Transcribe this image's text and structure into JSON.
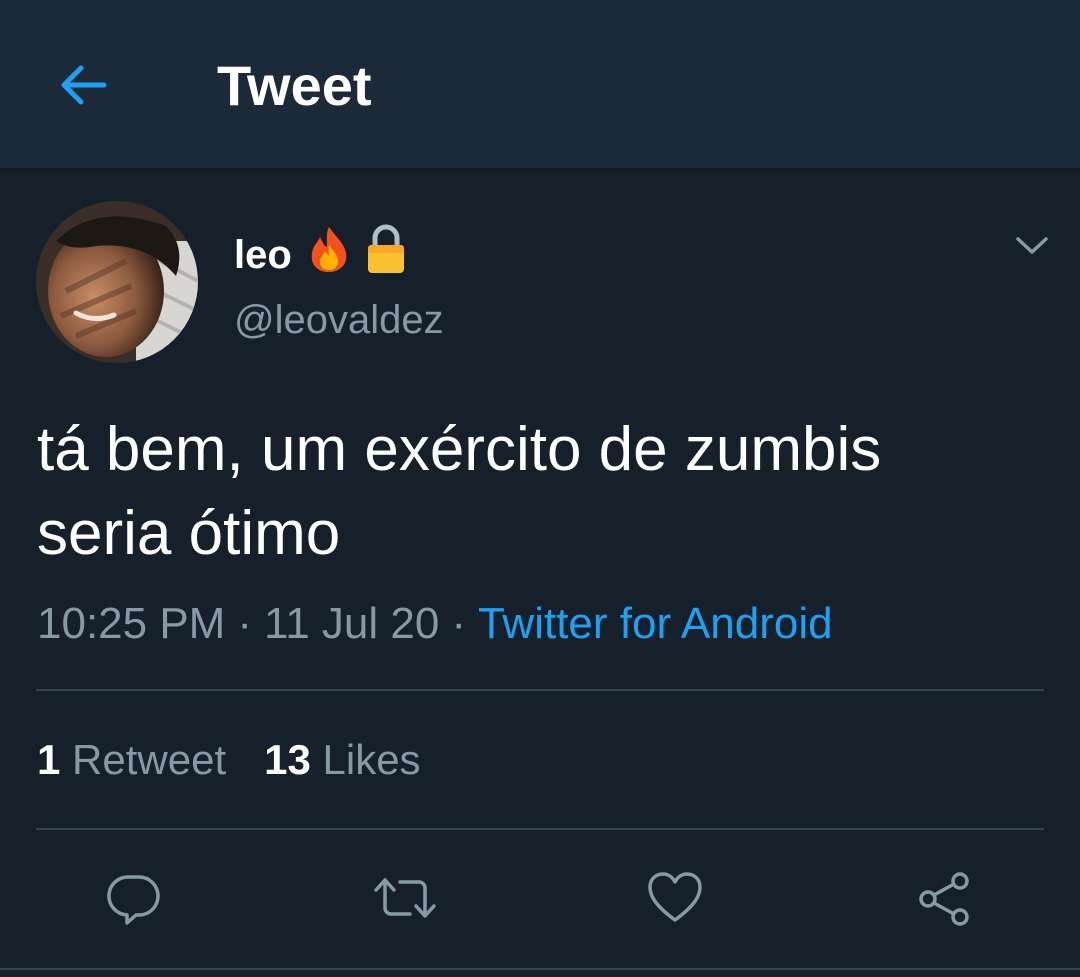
{
  "header": {
    "title": "Tweet",
    "back_icon": "arrow-left-icon"
  },
  "tweet": {
    "author": {
      "name": "leo",
      "emojis": [
        "fire-emoji",
        "lock-emoji"
      ],
      "handle": "@leovaldez"
    },
    "text": "tá bem, um exército de zumbis\nseria ótimo",
    "time": "10:25 PM",
    "date": "11 Jul 20",
    "separator": "·",
    "source": "Twitter for Android",
    "stats": {
      "retweets_count": "1",
      "retweets_label": "Retweet",
      "likes_count": "13",
      "likes_label": "Likes"
    }
  },
  "actions": [
    "reply-icon",
    "retweet-icon",
    "like-icon",
    "share-icon"
  ],
  "colors": {
    "background": "#15202b",
    "header_background": "#1c2938",
    "accent": "#1da1f2",
    "secondary_text": "#8899a6",
    "divider": "#38444d"
  }
}
